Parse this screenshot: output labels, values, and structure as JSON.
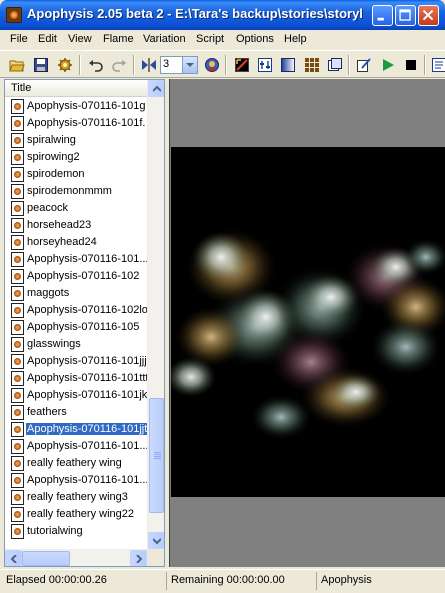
{
  "window": {
    "title": "Apophysis 2.05 beta 2 - E:\\Tara's backup\\stories\\storyl"
  },
  "menu": [
    "File",
    "Edit",
    "View",
    "Flame",
    "Variation",
    "Script",
    "Options",
    "Help"
  ],
  "toolbar": {
    "icons": [
      "open-folder-icon",
      "save-icon",
      "gear-icon",
      "undo-icon",
      "redo-icon",
      "mirror-icon",
      "render-icon",
      "edit-icon",
      "gradient-icon",
      "adjust-icon",
      "grid-icon",
      "mutate-icon",
      "script-edit-icon",
      "play-icon",
      "stop-icon"
    ],
    "combo_value": "3"
  },
  "list": {
    "header": "Title",
    "items": [
      "Apophysis-070116-101g",
      "Apophysis-070116-101f.",
      "spiralwing",
      "spirowing2",
      "spirodemon",
      "spirodemonmmm",
      "peacock",
      "horsehead23",
      "horseyhead24",
      "Apophysis-070116-101...",
      "Apophysis-070116-102",
      "maggots",
      "Apophysis-070116-102lo",
      "Apophysis-070116-105",
      "glasswings",
      "Apophysis-070116-101jjj",
      "Apophysis-070116-101ttt",
      "Apophysis-070116-101jk",
      "feathers",
      "Apophysis-070116-101jjt",
      "Apophysis-070116-101...",
      "really feathery wing",
      "Apophysis-070116-101...",
      "really feathery wing3",
      "really feathery wing22",
      "tutorialwing"
    ],
    "selected_index": 19
  },
  "status": {
    "elapsed": "Elapsed 00:00:00.26",
    "remaining": "Remaining 00:00:00.00",
    "name": "Apophysis"
  },
  "colors": {
    "titlebar": "#0b4fd4",
    "selection": "#316ac5",
    "preview_bg": "#808080",
    "render_bg": "#000000"
  }
}
